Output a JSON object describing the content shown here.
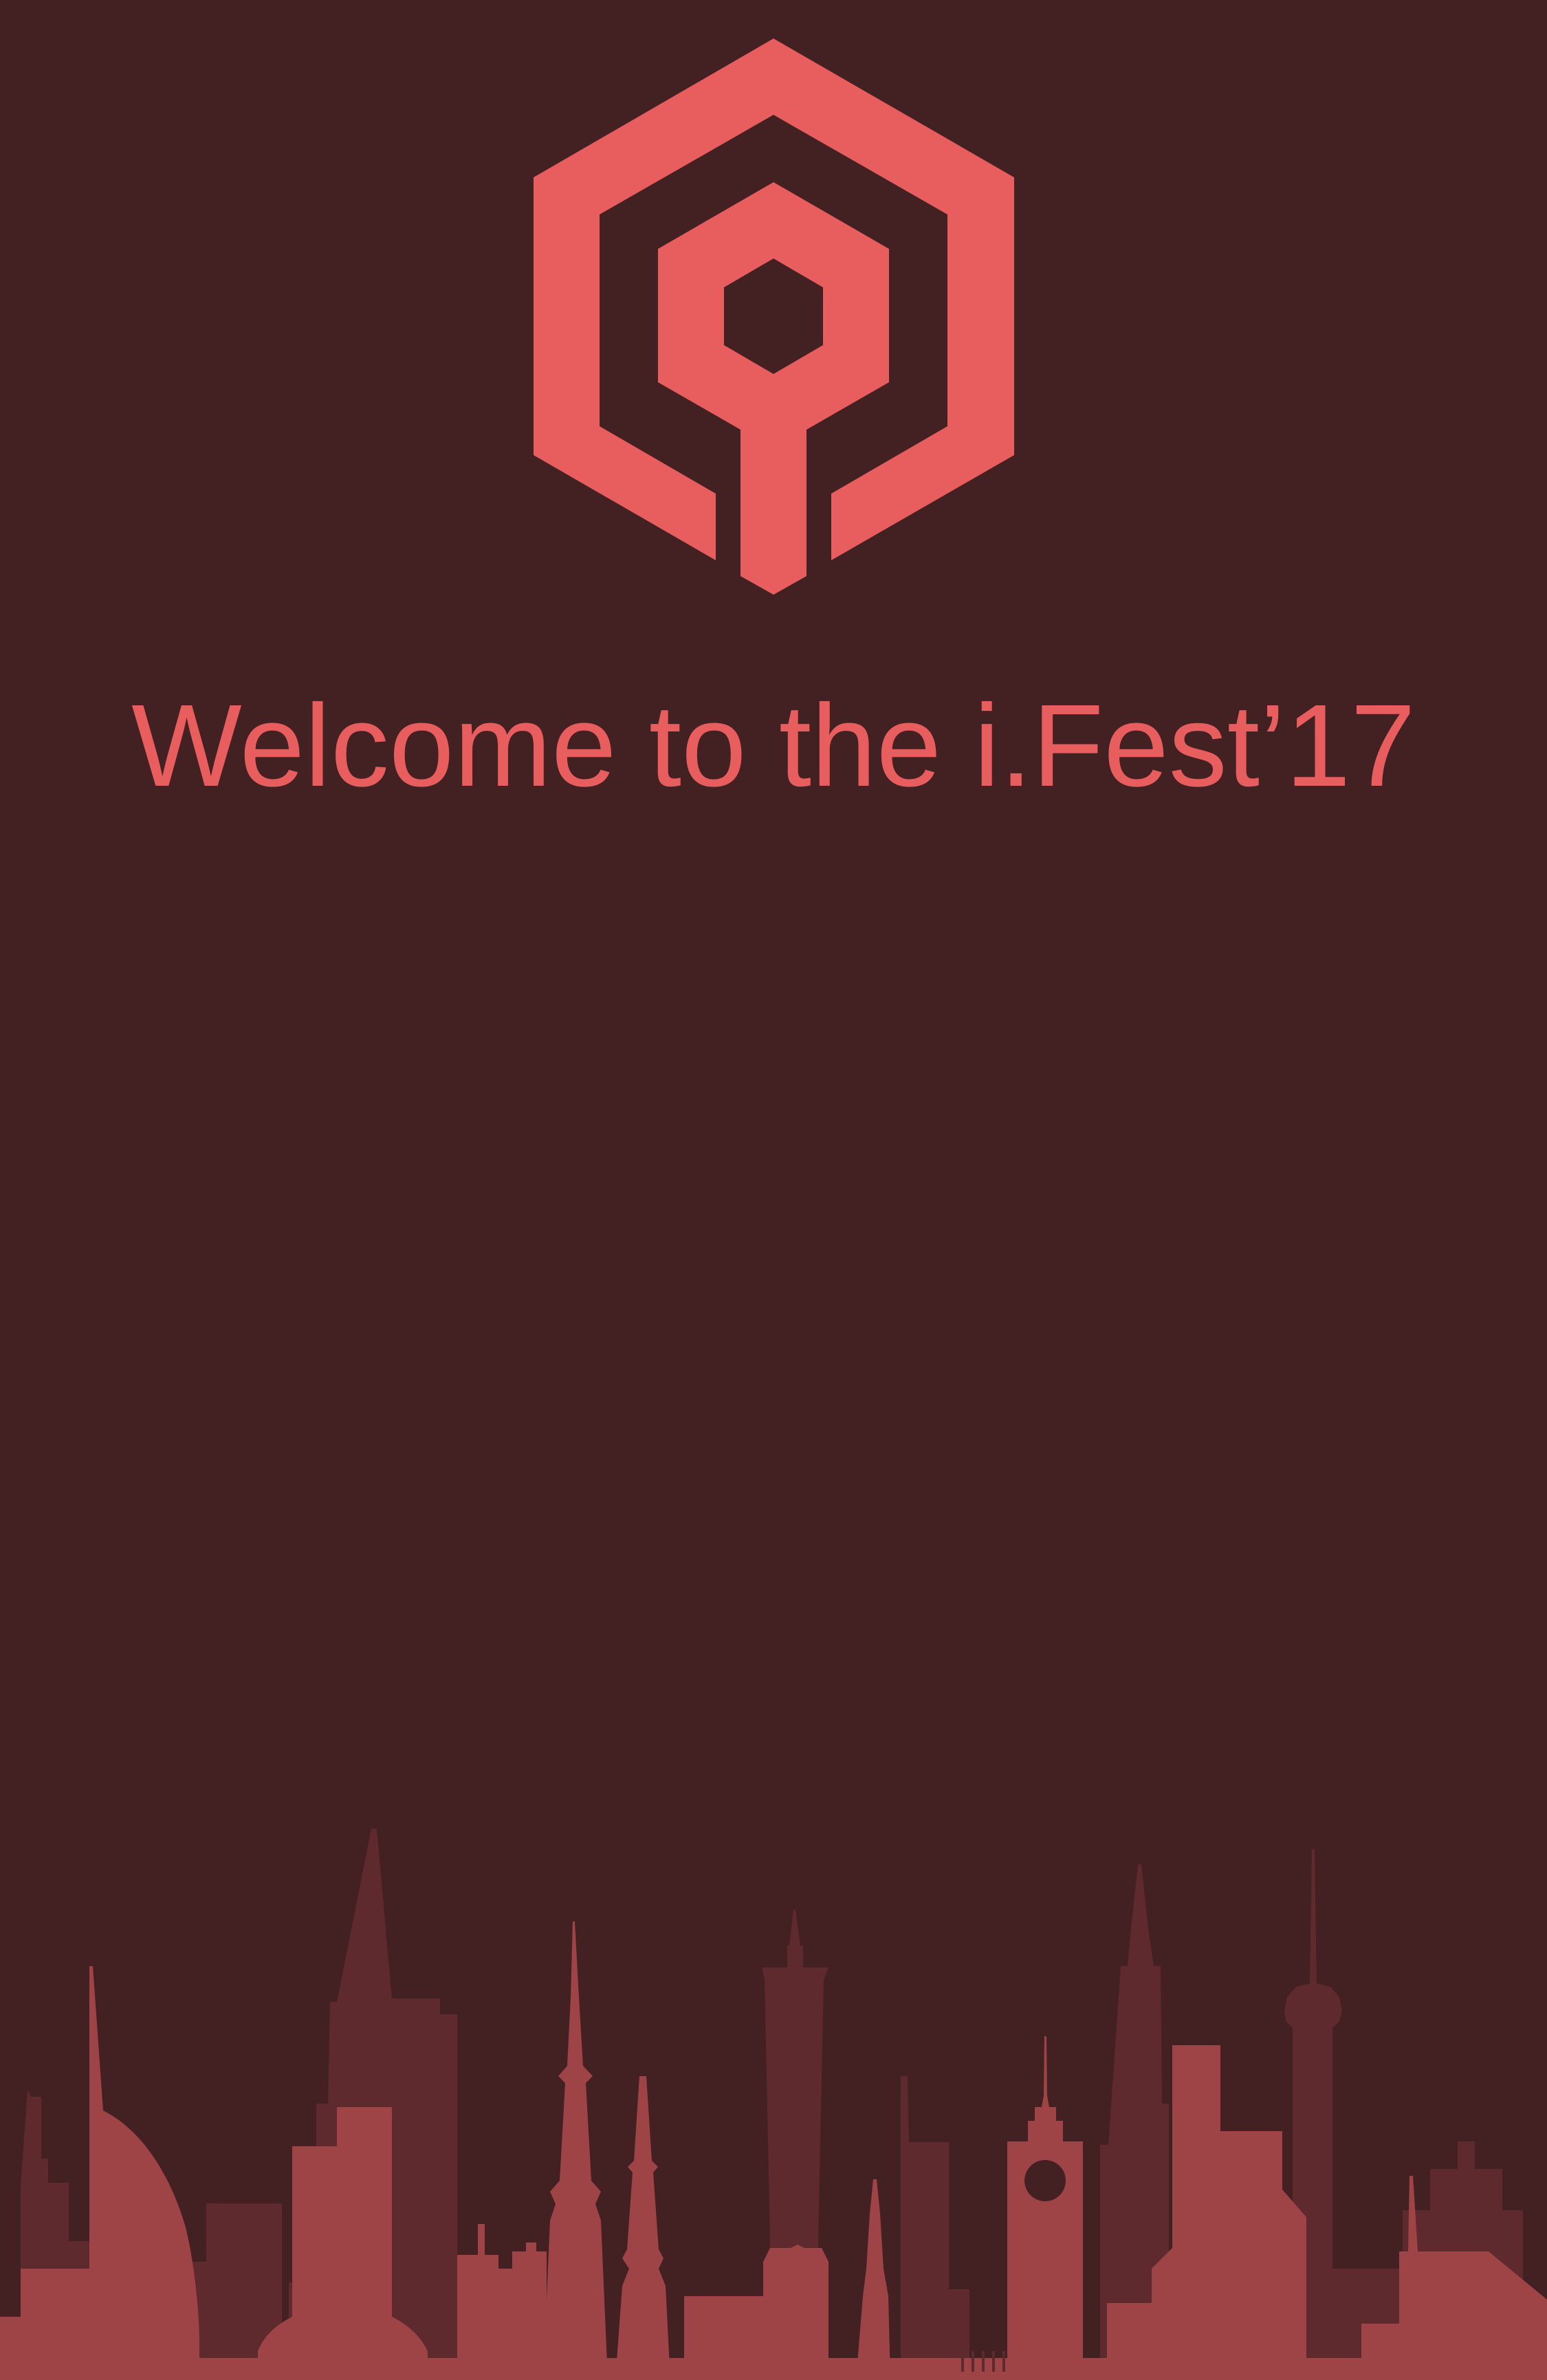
{
  "welcome_text": "Welcome to the i.Fest’17",
  "colors": {
    "background": "#432022",
    "accent": "#e85d5d",
    "skyline_back": "#5e2a2e",
    "skyline_front": "#9e4446"
  },
  "logo": {
    "icon": "hexagon-logo-icon"
  },
  "skyline": {
    "icon": "city-skyline-icon"
  }
}
